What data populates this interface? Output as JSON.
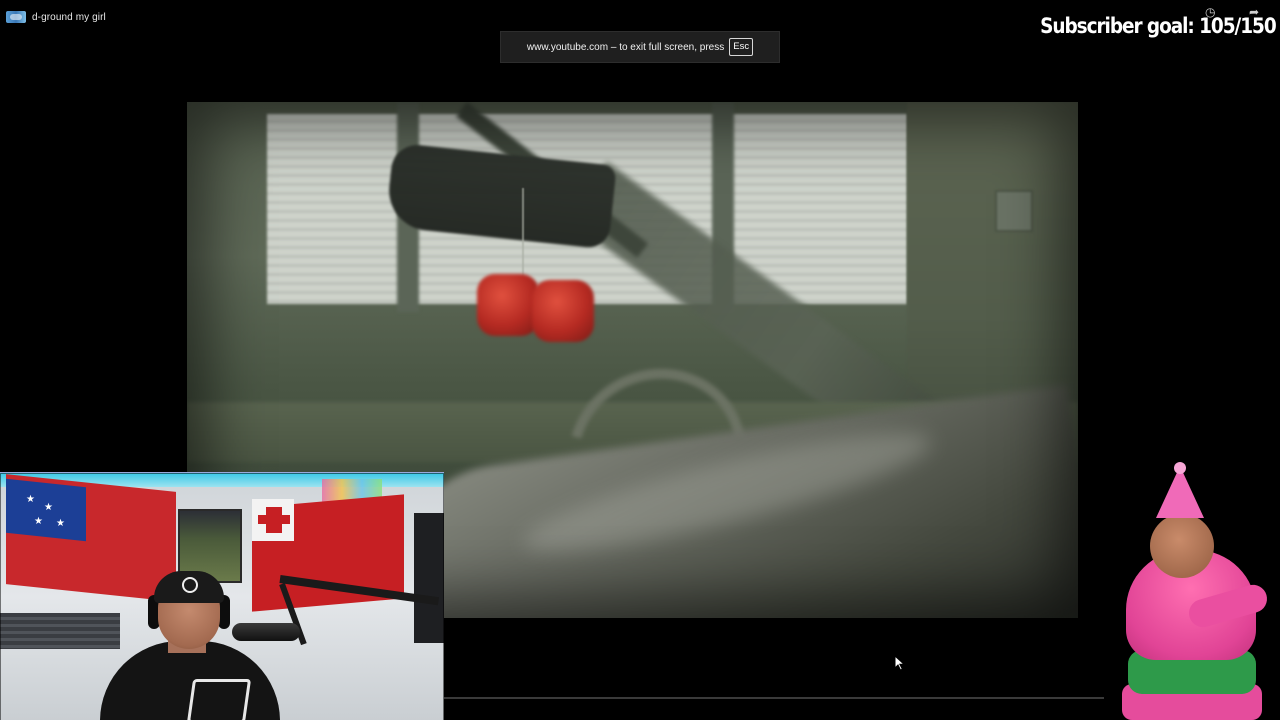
{
  "window": {
    "title": "d-ground my girl",
    "title_icon": "app-icon"
  },
  "fullscreen_notice": {
    "message": "www.youtube.com – to exit full screen, press",
    "key": "Esc"
  },
  "overlay": {
    "subscriber_goal": "Subscriber goal: 105/150",
    "icons": [
      "clock-icon",
      "share-icon"
    ]
  },
  "video": {
    "description_icon": "video-frame"
  },
  "cursor": {
    "icon": "arrow-cursor-icon"
  }
}
